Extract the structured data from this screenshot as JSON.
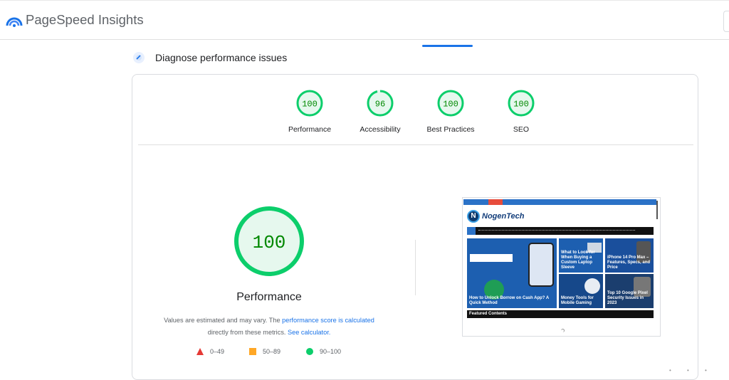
{
  "app": {
    "title": "PageSpeed Insights"
  },
  "section": {
    "title": "Diagnose performance issues"
  },
  "scores": [
    {
      "label": "Performance",
      "value": "100",
      "level": 1.0
    },
    {
      "label": "Accessibility",
      "value": "96",
      "level": 0.96
    },
    {
      "label": "Best Practices",
      "value": "100",
      "level": 1.0
    },
    {
      "label": "SEO",
      "value": "100",
      "level": 1.0
    }
  ],
  "main_score": {
    "value": "100",
    "label": "Performance",
    "level": 1.0
  },
  "note": {
    "text1": "Values are estimated and may vary. The ",
    "link1": "performance score is calculated",
    "text2": "directly from these metrics. ",
    "link2": "See calculator."
  },
  "legend": [
    {
      "range": "0–49",
      "shape": "triangle",
      "color": "#e53935"
    },
    {
      "range": "50–89",
      "shape": "square",
      "color": "#ffa726"
    },
    {
      "range": "90–100",
      "shape": "circle",
      "color": "#0cce6b"
    }
  ],
  "screenshot": {
    "site_name": "NogenTech",
    "tiles": [
      "How to Unlock Borrow on Cash App? A Quick Method",
      "What to Look for When Buying a Custom Laptop Sleeve",
      "iPhone 14 Pro Max – Features, Specs, and Price",
      "Money Tools for Mobile Gaming",
      "Top 10 Google Pixel Security Issues in 2023"
    ],
    "featured_label": "Featured Contents"
  },
  "colors": {
    "pass": "#0cce6b",
    "pass_text": "#008800",
    "pass_fill": "#e6f8ee",
    "link": "#1a73e8",
    "accent": "#1a73e8"
  }
}
